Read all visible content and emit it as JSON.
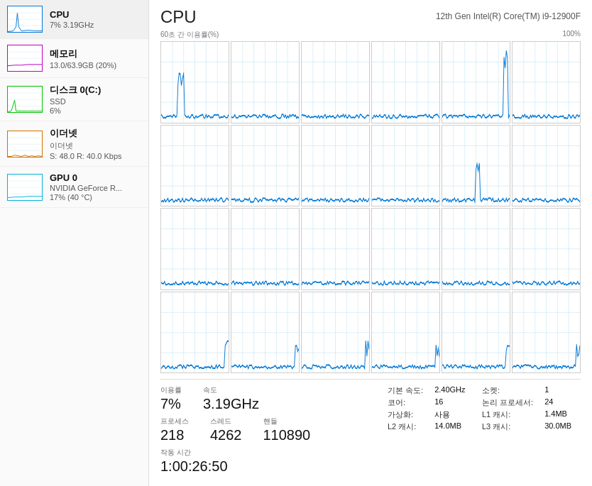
{
  "sidebar": {
    "items": [
      {
        "id": "cpu",
        "title": "CPU",
        "sub1": "7% 3.19GHz",
        "sub2": "",
        "borderColor": "#0078d7",
        "active": true
      },
      {
        "id": "memory",
        "title": "메모리",
        "sub1": "13.0/63.9GB (20%)",
        "sub2": "",
        "borderColor": "#c000c0",
        "active": false
      },
      {
        "id": "disk",
        "title": "디스크 0(C:)",
        "sub1": "SSD",
        "sub2": "6%",
        "borderColor": "#00c000",
        "active": false
      },
      {
        "id": "ethernet",
        "title": "이더넷",
        "sub1": "이더넷",
        "sub2": "S: 48.0  R: 40.0 Kbps",
        "borderColor": "#d07000",
        "active": false
      },
      {
        "id": "gpu",
        "title": "GPU 0",
        "sub1": "NVIDIA GeForce R...",
        "sub2": "17% (40 °C)",
        "borderColor": "#00b4d8",
        "active": false
      }
    ]
  },
  "main": {
    "title": "CPU",
    "cpu_model": "12th Gen Intel(R) Core(TM) i9-12900F",
    "chart_label_left": "60초 간 이용률(%)",
    "chart_label_right": "100%",
    "stats": {
      "utilization_label": "이용률",
      "utilization_value": "7%",
      "speed_label": "속도",
      "speed_value": "3.19GHz",
      "processes_label": "프로세스",
      "processes_value": "218",
      "threads_label": "스레드",
      "threads_value": "4262",
      "handles_label": "핸들",
      "handles_value": "110890",
      "uptime_label": "작동 시간",
      "uptime_value": "1:00:26:50"
    },
    "info": [
      {
        "label": "기본 속도:",
        "value": "2.40GHz"
      },
      {
        "label": "소켓:",
        "value": "1"
      },
      {
        "label": "코어:",
        "value": "16"
      },
      {
        "label": "논리 프로세서:",
        "value": "24"
      },
      {
        "label": "가상화:",
        "value": "사용"
      },
      {
        "label": "L1 캐시:",
        "value": "1.4MB"
      },
      {
        "label": "L2 캐시:",
        "value": "14.0MB"
      },
      {
        "label": "L3 캐시:",
        "value": "30.0MB"
      }
    ]
  }
}
